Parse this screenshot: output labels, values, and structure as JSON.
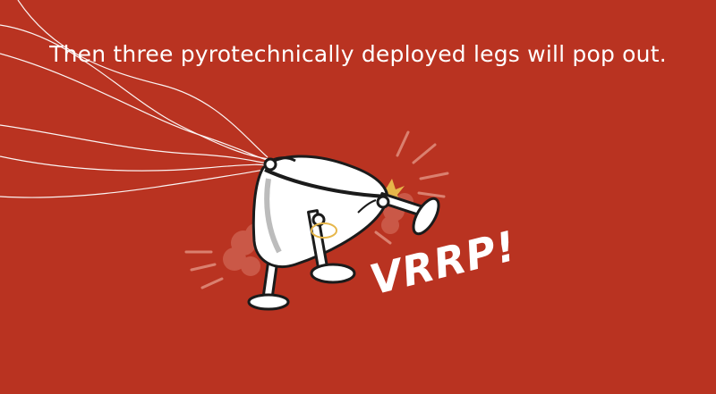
{
  "caption": "Then three pyrotechnically deployed legs will pop out.",
  "sound_effect": "VRRP!",
  "colors": {
    "background": "#b93321",
    "text": "#ffffff",
    "lander_body": "#ffffff",
    "outline": "#1b1b1b",
    "spark": "#e6b64a"
  },
  "illustration": {
    "subject": "lander-icon",
    "parachute_lines": "parachute-lines-icon",
    "smoke_puffs": "smoke-puff-icon",
    "spark": "spark-icon"
  }
}
